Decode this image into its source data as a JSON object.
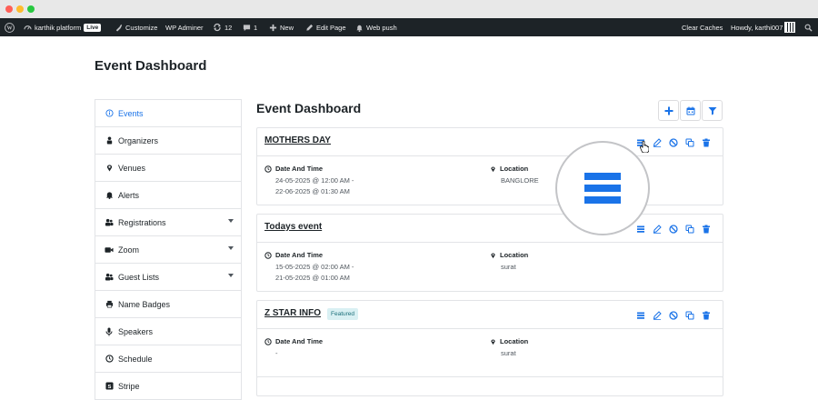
{
  "adminbar": {
    "site_name": "karthik platform",
    "live_badge": "Live",
    "customize": "Customize",
    "wp_adminer": "WP Adminer",
    "updates_count": "12",
    "comments_count": "1",
    "new": "New",
    "edit_page": "Edit Page",
    "web_push": "Web push",
    "clear_caches": "Clear Caches",
    "howdy": "Howdy, karthi007"
  },
  "page": {
    "title": "Event Dashboard"
  },
  "sidebar": {
    "items": [
      {
        "label": "Events",
        "icon": "info-icon"
      },
      {
        "label": "Organizers",
        "icon": "organizer-icon"
      },
      {
        "label": "Venues",
        "icon": "map-pin-icon"
      },
      {
        "label": "Alerts",
        "icon": "bell-icon"
      },
      {
        "label": "Registrations",
        "icon": "users-icon"
      },
      {
        "label": "Zoom",
        "icon": "video-icon"
      },
      {
        "label": "Guest Lists",
        "icon": "guests-icon"
      },
      {
        "label": "Name Badges",
        "icon": "printer-icon"
      },
      {
        "label": "Speakers",
        "icon": "microphone-icon"
      },
      {
        "label": "Schedule",
        "icon": "clock-icon"
      },
      {
        "label": "Stripe",
        "icon": "stripe-icon"
      }
    ]
  },
  "main": {
    "title": "Event Dashboard",
    "date_label": "Date And Time",
    "location_label": "Location",
    "events": [
      {
        "name": "MOTHERS DAY",
        "featured": "",
        "date_start": "24-05-2025 @ 12:00 AM -",
        "date_end": "22-06-2025 @ 01:30 AM",
        "location": "BANGLORE"
      },
      {
        "name": "Todays event",
        "featured": "",
        "date_start": "15-05-2025 @ 02:00 AM -",
        "date_end": "21-05-2025 @ 01:00 AM",
        "location": "surat"
      },
      {
        "name": "Z STAR INFO",
        "featured": "Featured",
        "date_start": "-",
        "date_end": "",
        "location": "surat"
      }
    ]
  },
  "colors": {
    "accent": "#1a73e8",
    "adminbar_bg": "#1d2327"
  }
}
